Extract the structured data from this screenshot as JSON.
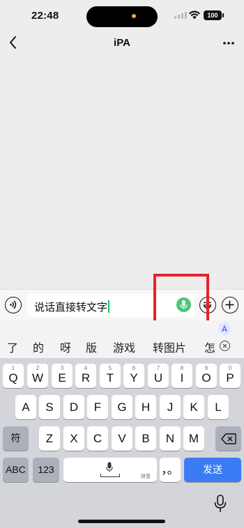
{
  "status_bar": {
    "time": "22:48",
    "battery": "100"
  },
  "nav": {
    "title": "iPA"
  },
  "composer": {
    "input_text": "说话直接转文字"
  },
  "ime": {
    "candidates": [
      "了",
      "的",
      "呀",
      "版",
      "游戏",
      "转图片",
      "怎"
    ],
    "row1": [
      {
        "hint": "1",
        "key": "Q"
      },
      {
        "hint": "2",
        "key": "W"
      },
      {
        "hint": "3",
        "key": "E"
      },
      {
        "hint": "4",
        "key": "R"
      },
      {
        "hint": "5",
        "key": "T"
      },
      {
        "hint": "6",
        "key": "Y"
      },
      {
        "hint": "7",
        "key": "U"
      },
      {
        "hint": "8",
        "key": "I"
      },
      {
        "hint": "9",
        "key": "O"
      },
      {
        "hint": "0",
        "key": "P"
      }
    ],
    "row2": [
      "A",
      "S",
      "D",
      "F",
      "G",
      "H",
      "J",
      "K",
      "L"
    ],
    "row3": [
      "Z",
      "X",
      "C",
      "V",
      "B",
      "N",
      "M"
    ],
    "symbol_key": "符",
    "abc_key": "ABC",
    "num_key": "123",
    "space_label": "拼音",
    "punct_key": "，。",
    "send_key": "发送"
  },
  "colors": {
    "accent_green": "#07c160",
    "mic_green": "#4cc779",
    "send_blue": "#3b7cf4",
    "highlight_red": "#e8212a"
  },
  "icons": [
    "back-icon",
    "more-icon",
    "voice-toggle-icon",
    "mic-icon",
    "emoji-icon",
    "add-icon",
    "ai-assistant-icon",
    "close-circle-icon",
    "backspace-icon",
    "dictation-mic-icon"
  ]
}
